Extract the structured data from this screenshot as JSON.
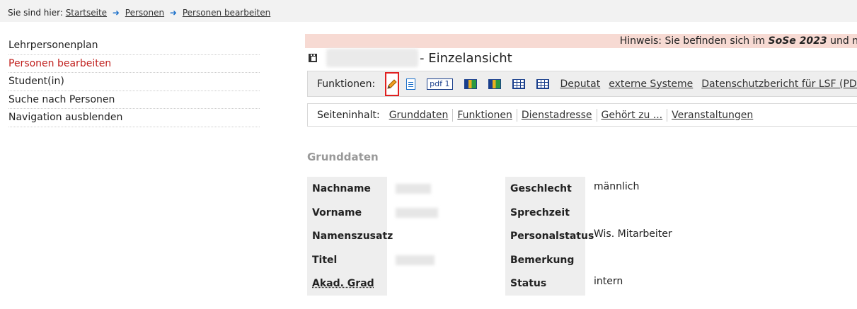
{
  "breadcrumb": {
    "prefix": "Sie sind hier:",
    "items": [
      "Startseite",
      "Personen",
      "Personen bearbeiten"
    ]
  },
  "sidebar": {
    "items": [
      {
        "label": "Lehrpersonenplan",
        "active": false
      },
      {
        "label": "Personen bearbeiten",
        "active": true
      },
      {
        "label": "Student(in)",
        "active": false
      },
      {
        "label": "Suche nach Personen",
        "active": false
      },
      {
        "label": "Navigation ausblenden",
        "active": false
      }
    ]
  },
  "notice": {
    "prefix": "Hinweis: Sie befinden sich im ",
    "semester": "SoSe 2023",
    "suffix": " und nicht"
  },
  "page": {
    "title_suffix": "- Einzelansicht"
  },
  "functions": {
    "label": "Funktionen:",
    "pdf_label": "pdf 1",
    "links": [
      "Deputat",
      "externe Systeme",
      "Datenschutzbericht für LSF (PDF)"
    ]
  },
  "page_content": {
    "label": "Seiteninhalt:",
    "links": [
      "Grunddaten",
      "Funktionen",
      "Dienstadresse",
      "Gehört zu ...",
      "Veranstaltungen"
    ]
  },
  "grunddaten": {
    "title": "Grunddaten",
    "left": [
      {
        "label": "Nachname",
        "value": ""
      },
      {
        "label": "Vorname",
        "value": ""
      },
      {
        "label": "Namenszusatz",
        "value": ""
      },
      {
        "label": "Titel",
        "value": ""
      },
      {
        "label": "Akad. Grad",
        "value": ""
      }
    ],
    "right": [
      {
        "label": "Geschlecht",
        "value": "männlich"
      },
      {
        "label": "Sprechzeit",
        "value": ""
      },
      {
        "label": "Personalstatus",
        "value": "Wis. Mitarbeiter"
      },
      {
        "label": "Bemerkung",
        "value": ""
      },
      {
        "label": "Status",
        "value": "intern"
      }
    ]
  },
  "colors": {
    "accent_red": "#c0201e",
    "notice_bg": "#f7dad3",
    "link_blue": "#1a6fc9",
    "highlight_border": "#e02020"
  }
}
